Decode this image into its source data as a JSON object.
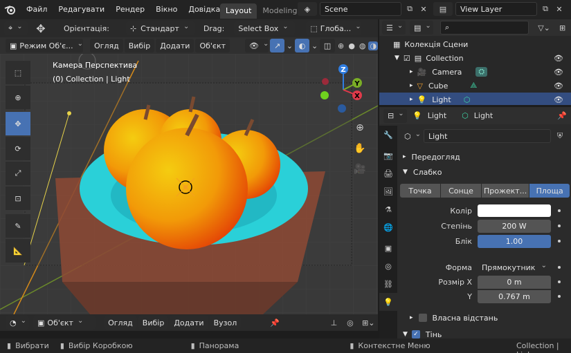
{
  "topbar": {
    "menu": [
      "Файл",
      "Редагувати",
      "Рендер",
      "Вікно",
      "Довідка"
    ],
    "workspaces": [
      "Layout",
      "Modeling"
    ],
    "active_workspace": "Layout",
    "scene": "Scene",
    "view_layer": "View Layer"
  },
  "viewport_header": {
    "orientation_label": "Орієнтація:",
    "orientation_value": "Стандарт",
    "drag_label": "Drag:",
    "drag_value": "Select Box",
    "transform_value": "Глоба..."
  },
  "viewport_header2": {
    "mode": "Режим Об'є...",
    "menus": [
      "Огляд",
      "Вибір",
      "Додати",
      "Об'єкт"
    ]
  },
  "viewport": {
    "camera_title": "Камера Перспектива",
    "camera_sub": "(0) Collection | Light",
    "gizmo_labels": [
      "Z",
      "Y",
      "X"
    ]
  },
  "viewport_footer": {
    "mode": "Об'єкт",
    "menus": [
      "Огляд",
      "Вибір",
      "Додати",
      "Вузол"
    ]
  },
  "statusbar": {
    "items": [
      "Вибрати",
      "Вибір Коробкою",
      "Панорама",
      "Контекстне Меню"
    ],
    "right": "Collection | Ligh"
  },
  "outliner": {
    "rows": [
      {
        "label": "Колекція Сцени",
        "icon": "scene-collection-icon"
      },
      {
        "label": "Collection",
        "icon": "collection-icon"
      },
      {
        "label": "Camera",
        "icon": "camera-icon"
      },
      {
        "label": "Cube",
        "icon": "mesh-icon"
      },
      {
        "label": "Light",
        "icon": "light-icon",
        "selected": true
      }
    ]
  },
  "properties": {
    "header_object": "Light",
    "header_data": "Light",
    "datablock_name": "Light",
    "sections": {
      "preview": "Передогляд",
      "light": "Слабко",
      "custom_distance": "Власна відстань",
      "shadow": "Тінь"
    },
    "light_types": [
      "Точка",
      "Сонце",
      "Прожект...",
      "Площа"
    ],
    "active_light_type": "Площа",
    "fields": {
      "color_label": "Колір",
      "power_label": "Степінь",
      "power_value": "200 W",
      "specular_label": "Блік",
      "specular_value": "1.00",
      "specular_fraction": 1.0,
      "shape_label": "Форма",
      "shape_value": "Прямокутник",
      "size_x_label": "Розмір X",
      "size_x_value": "0 m",
      "y_label": "Y",
      "y_value": "0.767 m"
    }
  },
  "colors": {
    "accent": "#4772b3",
    "selected_row": "#334d80",
    "light_color": "#ffffff"
  }
}
